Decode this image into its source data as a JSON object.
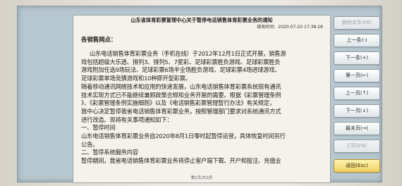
{
  "notice": {
    "title": "山东省体育彩票管理中心关于暂停电话销售体育彩票业务的通知",
    "publish_time": "接收时间：2020-07-20 17:38:28",
    "greeting": "各销售网点：",
    "paragraphs": [
      "山东电话销售体育彩票业务（手机在线）于2012年12月1日正式开展，销售游",
      "戏包括超级大乐透、排列3、排列5、7星彩、足球彩票胜负游戏、足球彩票胜负",
      "游戏附加任选9场玩法、足球彩票6场半全场胜负游戏、足球彩票4场进球游戏、",
      "足球彩票单场竞猜游戏和10种即开型彩票。",
      "随着移动通讯网络技术和应用的快速发展，山东电话销售体育彩票系统现有通讯",
      "技术实现方式已不能继续兼顾政策合规和业务开展的需要。根据《彩票管理条例",
      "》、《彩票管理条例实施细则》以及《电话销售彩票管理暂行办法》有关规定，",
      "我中心决定暂停我省电话销售体育彩票业务，按照管理部门要求对系统通讯方式",
      "进行改造。现将有关事项通知如下：",
      "一、暂停时间",
      "山东电话销售体育彩票业务自2020年8月1日零时起暂停运营，具体恢复时间另行",
      "公告。",
      "二、暂停系统服务内容",
      "暂停期间，我省电话销售体育彩票业务将停止客户端下载、开户和投注、充值业"
    ],
    "page_indicator": "第1页/共3页"
  },
  "buttons": [
    {
      "label": "删除本条(F6)",
      "enabled": false
    },
    {
      "label": "上一条(-)",
      "enabled": true
    },
    {
      "label": "下一条(+)",
      "enabled": true
    },
    {
      "label": "第一页(←)",
      "enabled": true
    },
    {
      "label": "上一页(↑)",
      "enabled": true
    },
    {
      "label": "下一页(↓)",
      "enabled": true
    },
    {
      "label": "最末页(→)",
      "enabled": true
    },
    {
      "label": "打印(F8)",
      "enabled": false
    },
    {
      "label": "返回(Esc)",
      "enabled": true
    }
  ]
}
